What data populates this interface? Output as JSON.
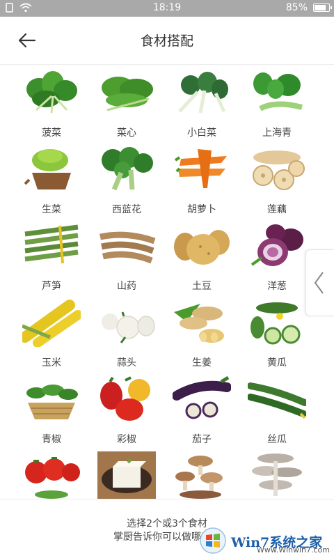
{
  "status": {
    "time": "18:19",
    "battery": "85%",
    "battery_level": 0.85
  },
  "header": {
    "title": "食材搭配"
  },
  "ingredients": [
    {
      "label": "菠菜",
      "icon": "spinach"
    },
    {
      "label": "菜心",
      "icon": "choy-sum"
    },
    {
      "label": "小白菜",
      "icon": "bok-choy"
    },
    {
      "label": "上海青",
      "icon": "shanghai-green"
    },
    {
      "label": "生菜",
      "icon": "lettuce"
    },
    {
      "label": "西蓝花",
      "icon": "broccoli"
    },
    {
      "label": "胡萝卜",
      "icon": "carrot"
    },
    {
      "label": "莲藕",
      "icon": "lotus-root"
    },
    {
      "label": "芦笋",
      "icon": "asparagus"
    },
    {
      "label": "山药",
      "icon": "yam"
    },
    {
      "label": "土豆",
      "icon": "potato"
    },
    {
      "label": "洋葱",
      "icon": "onion"
    },
    {
      "label": "玉米",
      "icon": "corn"
    },
    {
      "label": "蒜头",
      "icon": "garlic"
    },
    {
      "label": "生姜",
      "icon": "ginger"
    },
    {
      "label": "黄瓜",
      "icon": "cucumber"
    },
    {
      "label": "青椒",
      "icon": "green-pepper"
    },
    {
      "label": "彩椒",
      "icon": "bell-pepper"
    },
    {
      "label": "茄子",
      "icon": "eggplant"
    },
    {
      "label": "丝瓜",
      "icon": "luffa"
    },
    {
      "label": "",
      "icon": "tomato"
    },
    {
      "label": "",
      "icon": "tofu"
    },
    {
      "label": "",
      "icon": "mushroom"
    },
    {
      "label": "",
      "icon": "oyster-mushroom"
    }
  ],
  "footer": {
    "hint_line1": "选择2个或3个食材",
    "hint_line2": "掌厨告诉你可以做哪些菜"
  },
  "watermark": {
    "text": "Win7系统之家",
    "url": "Www.Winwin7.com"
  },
  "colors": {
    "statusbar": "#a9a9a9",
    "accent": "#1d5fa8"
  }
}
